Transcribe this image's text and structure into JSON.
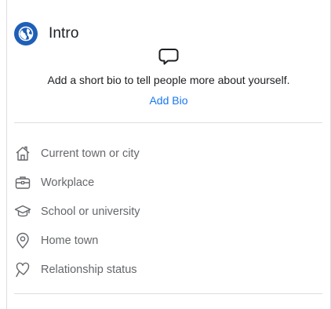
{
  "intro": {
    "title": "Intro",
    "header_icon": "globe-icon",
    "bio": {
      "prompt": "Add a short bio to tell people more about yourself.",
      "action_label": "Add Bio",
      "icon": "speech-bubble-icon"
    },
    "details": [
      {
        "label": "Current town or city",
        "icon": "house-icon"
      },
      {
        "label": "Workplace",
        "icon": "briefcase-icon"
      },
      {
        "label": "School or university",
        "icon": "graduation-cap-icon"
      },
      {
        "label": "Home town",
        "icon": "location-pin-icon"
      },
      {
        "label": "Relationship status",
        "icon": "heart-icon"
      }
    ]
  },
  "colors": {
    "accent": "#1877f2",
    "header_icon_bg": "#1e5fb8",
    "muted_text": "#65676b",
    "divider": "#dadde1"
  }
}
